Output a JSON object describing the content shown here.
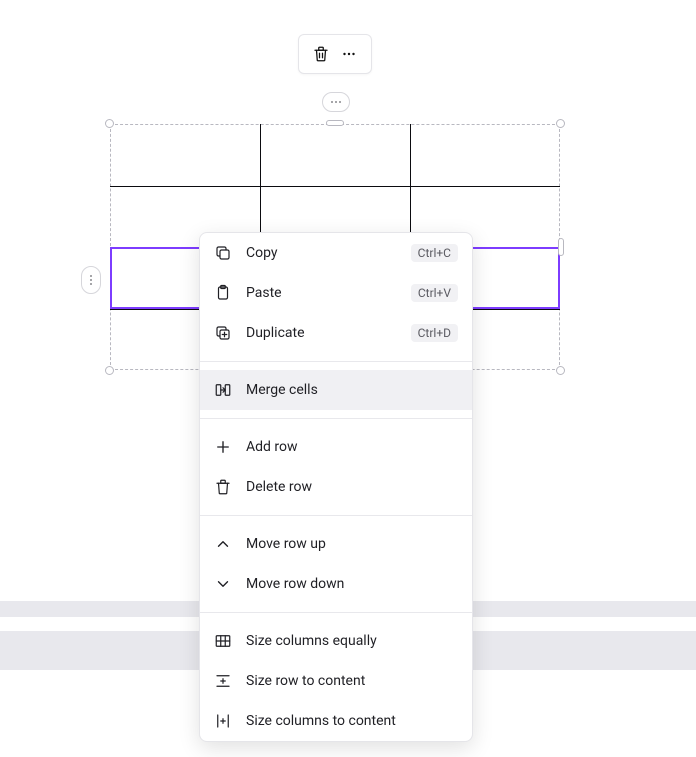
{
  "table": {
    "rows": 4,
    "cols": 3,
    "selected_row_index": 2
  },
  "toolbar": {
    "trash_label": "Delete",
    "more_label": "More"
  },
  "context_menu": {
    "group1": [
      {
        "icon": "copy",
        "label": "Copy",
        "shortcut": "Ctrl+C"
      },
      {
        "icon": "paste",
        "label": "Paste",
        "shortcut": "Ctrl+V"
      },
      {
        "icon": "duplicate",
        "label": "Duplicate",
        "shortcut": "Ctrl+D"
      }
    ],
    "group2": [
      {
        "icon": "merge",
        "label": "Merge cells",
        "highlighted": true
      }
    ],
    "group3": [
      {
        "icon": "add-row",
        "label": "Add row"
      },
      {
        "icon": "delete-row",
        "label": "Delete row"
      }
    ],
    "group4": [
      {
        "icon": "move-up",
        "label": "Move row up"
      },
      {
        "icon": "move-down",
        "label": "Move row down"
      }
    ],
    "group5": [
      {
        "icon": "size-cols-equal",
        "label": "Size columns equally"
      },
      {
        "icon": "size-row-content",
        "label": "Size row to content"
      },
      {
        "icon": "size-cols-content",
        "label": "Size columns to content"
      }
    ]
  }
}
